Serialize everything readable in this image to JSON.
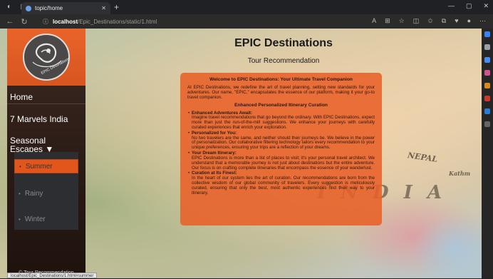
{
  "browser": {
    "tab_title": "topic/home",
    "url_host": "localhost",
    "url_path": "/Epic_Destinations/static/1.html",
    "new_tab_icon": "plus-icon"
  },
  "map": {
    "nepal": "NEPAL",
    "india": "I N D I A",
    "kathmandu": "Kathm"
  },
  "sidebar": {
    "logo_text": "EPIC Destinations",
    "home": "Home",
    "marvels": "7 Marvels India",
    "seasonal_line1": "Seasonal",
    "seasonal_line2": "Escapes ▼",
    "submenu": [
      "Summer",
      "Rainy",
      "Winter"
    ],
    "footer": "© Tour Recommendation"
  },
  "status_text": "localhost/Epic_Destinations/1.html#summer",
  "header": {
    "title": "EPIC Destinations",
    "subtitle": "Tour Recommendation"
  },
  "card": {
    "heading": "Welcome to EPIC Destinations: Your Ultimate Travel Companion",
    "intro": "At EPIC Destinations, we redefine the art of travel planning, setting new standards for your adventures. Our name, \"EPIC,\" encapsulates the essence of our platform, making it your go-to travel companion.",
    "section_title": "Enhanced Personalized Itinerary Curation",
    "items": [
      {
        "title": "Enhanced Adventures Await:",
        "text": "Imagine travel recommendations that go beyond the ordinary. With EPIC Destinations, expect more than just the run-of-the-mill suggestions. We enhance your journeys with carefully curated experiences that enrich your exploration."
      },
      {
        "title": "Personalized for You:",
        "text": "No two travelers are the same, and neither should their journeys be. We believe in the power of personalization. Our collaborative filtering technology tailors every recommendation to your unique preferences, ensuring your trips are a reflection of your dreams."
      },
      {
        "title": "Your Dream Itinerary:",
        "text": "EPIC Destinations is more than a list of places to visit; it's your personal travel architect. We understand that a memorable journey is not just about destinations but the entire adventure. Our focus is on crafting complete itineraries that encompass the essence of your wanderlust."
      },
      {
        "title": "Curation at Its Finest:",
        "text": "In the heart of our system lies the art of curation. Our recommendations are born from the collective wisdom of our global community of travelers. Every suggestion is meticulously curated, ensuring that only the best, most authentic experiences find their way to your itinerary."
      }
    ]
  }
}
